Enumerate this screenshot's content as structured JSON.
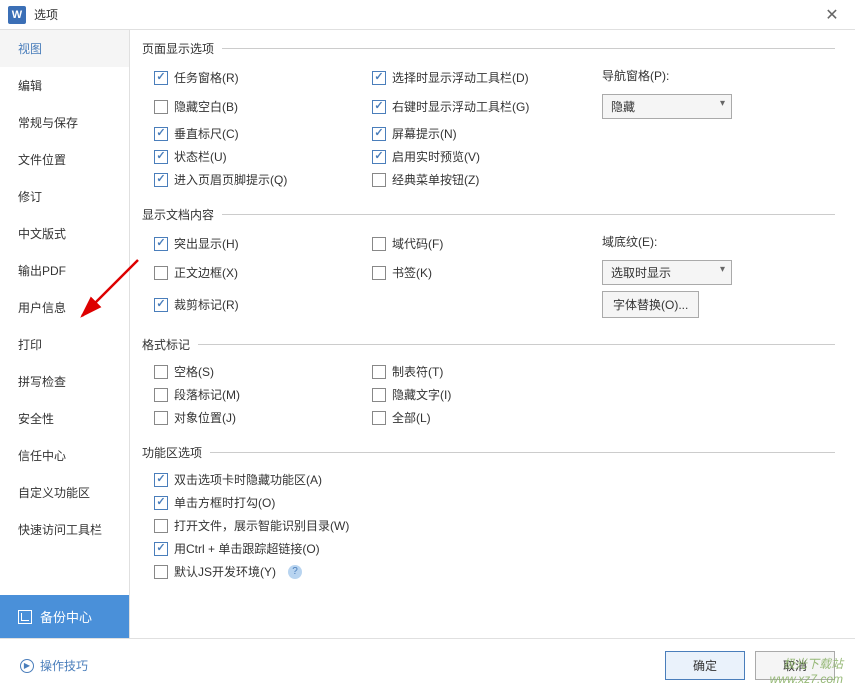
{
  "titlebar": {
    "app_icon": "W",
    "title": "选项"
  },
  "sidebar": {
    "items": [
      "视图",
      "编辑",
      "常规与保存",
      "文件位置",
      "修订",
      "中文版式",
      "输出PDF",
      "用户信息",
      "打印",
      "拼写检查",
      "安全性",
      "信任中心",
      "自定义功能区",
      "快速访问工具栏"
    ],
    "backup": "备份中心"
  },
  "sections": {
    "page_display": {
      "legend": "页面显示选项",
      "r1c1": "任务窗格(R)",
      "r1c2": "选择时显示浮动工具栏(D)",
      "r2c1": "隐藏空白(B)",
      "r2c2": "右键时显示浮动工具栏(G)",
      "r3c1": "垂直标尺(C)",
      "r3c2": "屏幕提示(N)",
      "r4c1": "状态栏(U)",
      "r4c2": "启用实时预览(V)",
      "r5c1": "进入页眉页脚提示(Q)",
      "r5c2": "经典菜单按钮(Z)",
      "nav_label": "导航窗格(P):",
      "nav_value": "隐藏"
    },
    "doc_content": {
      "legend": "显示文档内容",
      "r1c1": "突出显示(H)",
      "r1c2": "域代码(F)",
      "r2c1": "正文边框(X)",
      "r2c2": "书签(K)",
      "r3c1": "裁剪标记(R)",
      "shade_label": "域底纹(E):",
      "shade_value": "选取时显示",
      "font_sub": "字体替换(O)..."
    },
    "format_marks": {
      "legend": "格式标记",
      "r1c1": "空格(S)",
      "r1c2": "制表符(T)",
      "r2c1": "段落标记(M)",
      "r2c2": "隐藏文字(I)",
      "r3c1": "对象位置(J)",
      "r3c2": "全部(L)"
    },
    "ribbon": {
      "legend": "功能区选项",
      "r1": "双击选项卡时隐藏功能区(A)",
      "r2": "单击方框时打勾(O)",
      "r3": "打开文件，展示智能识别目录(W)",
      "r4": "用Ctrl + 单击跟踪超链接(O)",
      "r5": "默认JS开发环境(Y)"
    }
  },
  "footer": {
    "tips": "操作技巧",
    "ok": "确定",
    "cancel": "取消"
  },
  "watermark": {
    "line1": "极光下载站",
    "line2": "www.xz7.com"
  }
}
